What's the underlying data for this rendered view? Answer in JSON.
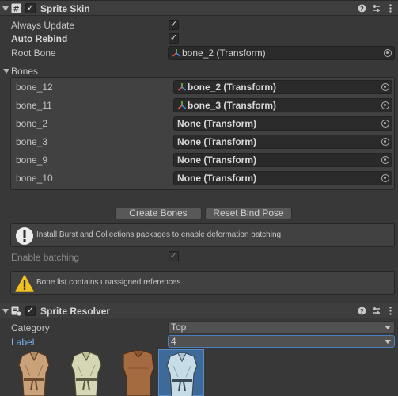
{
  "sprite_skin": {
    "title": "Sprite Skin",
    "enabled_check": "✓",
    "always_update_label": "Always Update",
    "always_update_check": "✓",
    "auto_rebind_label": "Auto Rebind",
    "auto_rebind_check": "✓",
    "root_bone_label": "Root Bone",
    "root_bone_value": "bone_2 (Transform)",
    "bones_label": "Bones",
    "bones": [
      {
        "name": "bone_12",
        "value": "bone_2 (Transform)"
      },
      {
        "name": "bone_11",
        "value": "bone_3 (Transform)"
      },
      {
        "name": "bone_2",
        "value": "None (Transform)"
      },
      {
        "name": "bone_3",
        "value": "None (Transform)"
      },
      {
        "name": "bone_9",
        "value": "None (Transform)"
      },
      {
        "name": "bone_10",
        "value": "None (Transform)"
      }
    ],
    "create_bones_label": "Create Bones",
    "reset_bind_pose_label": "Reset Bind Pose",
    "info_message": "Install Burst and Collections packages to enable deformation batching.",
    "enable_batching_label": "Enable batching",
    "enable_batching_check": "✓",
    "warning_message": "Bone list contains unassigned references"
  },
  "sprite_resolver": {
    "title": "Sprite Resolver",
    "enabled_check": "✓",
    "category_label": "Category",
    "category_value": "Top",
    "label_label": "Label",
    "label_value": "4"
  },
  "header_icons": [
    "help-icon",
    "preset-icon",
    "more-icon"
  ],
  "colors": {
    "background": "#383838",
    "field_bg": "#2a2a2a",
    "label_highlight": "#7ab4f5",
    "warning_yellow": "#f2c01e",
    "selected_thumb": "#3e6a9a"
  }
}
